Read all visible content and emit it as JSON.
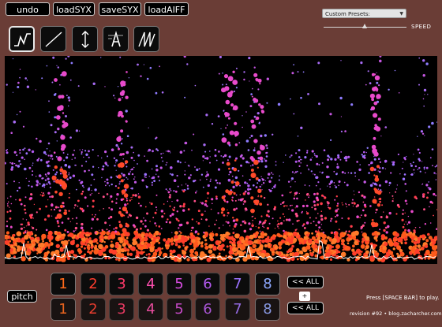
{
  "toolbar": {
    "undo_label": "undo",
    "loadsyx_label": "loadSYX",
    "savesyx_label": "saveSYX",
    "loadaiff_label": "loadAIFF"
  },
  "tools": [
    "wave-shape-icon",
    "diagonal-line-icon",
    "vertical-arrows-icon",
    "scale-text-icon",
    "zigzag-icon"
  ],
  "presets": {
    "selected": "Custom Presets:"
  },
  "speed": {
    "label": "SPEED",
    "level": 0.5
  },
  "pitch_label": "pitch",
  "number_rows": {
    "top": [
      "1",
      "2",
      "3",
      "4",
      "5",
      "6",
      "7",
      "8"
    ],
    "bottom": [
      "1",
      "2",
      "3",
      "4",
      "5",
      "6",
      "7",
      "8"
    ],
    "colors": [
      "#ff6a1a",
      "#ff3d2e",
      "#ff3a6a",
      "#ff4fb0",
      "#d64ce0",
      "#b35af0",
      "#9c72ff",
      "#8da8ff"
    ]
  },
  "all_buttons": {
    "top": "<< ALL",
    "plus": "+",
    "bottom": "<< ALL"
  },
  "hint_text": "Press [SPACE BAR] to play.",
  "revision_text": "revision #92 • blog.zacharcher.com"
}
